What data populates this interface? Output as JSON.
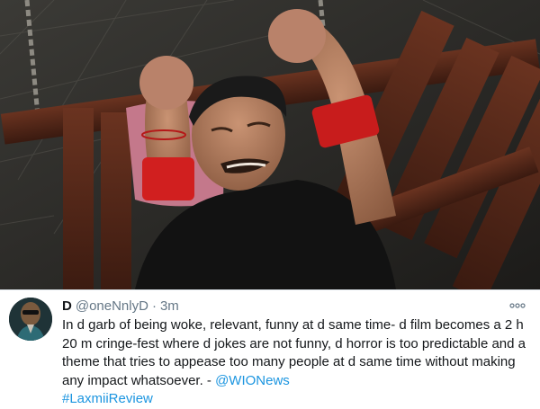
{
  "tweet": {
    "author_name": "D",
    "handle": "@oneNnlyD",
    "separator": "·",
    "time": "3m",
    "more_icon": "more-horizontal-icon",
    "text": "In d garb of being woke, relevant, funny at d same time- d film becomes a 2 h 20 m cringe-fest where d jokes are not funny, d horror is too predictable and a theme that tries to appease too many people at d same time without making any impact whatsoever. - ",
    "mention": "@WIONews",
    "hashtag": "#LaxmiiReview"
  },
  "colors": {
    "link": "#1b95e0",
    "text": "#14171a",
    "secondary": "#657786",
    "bangle_red": "#d11f1f"
  }
}
